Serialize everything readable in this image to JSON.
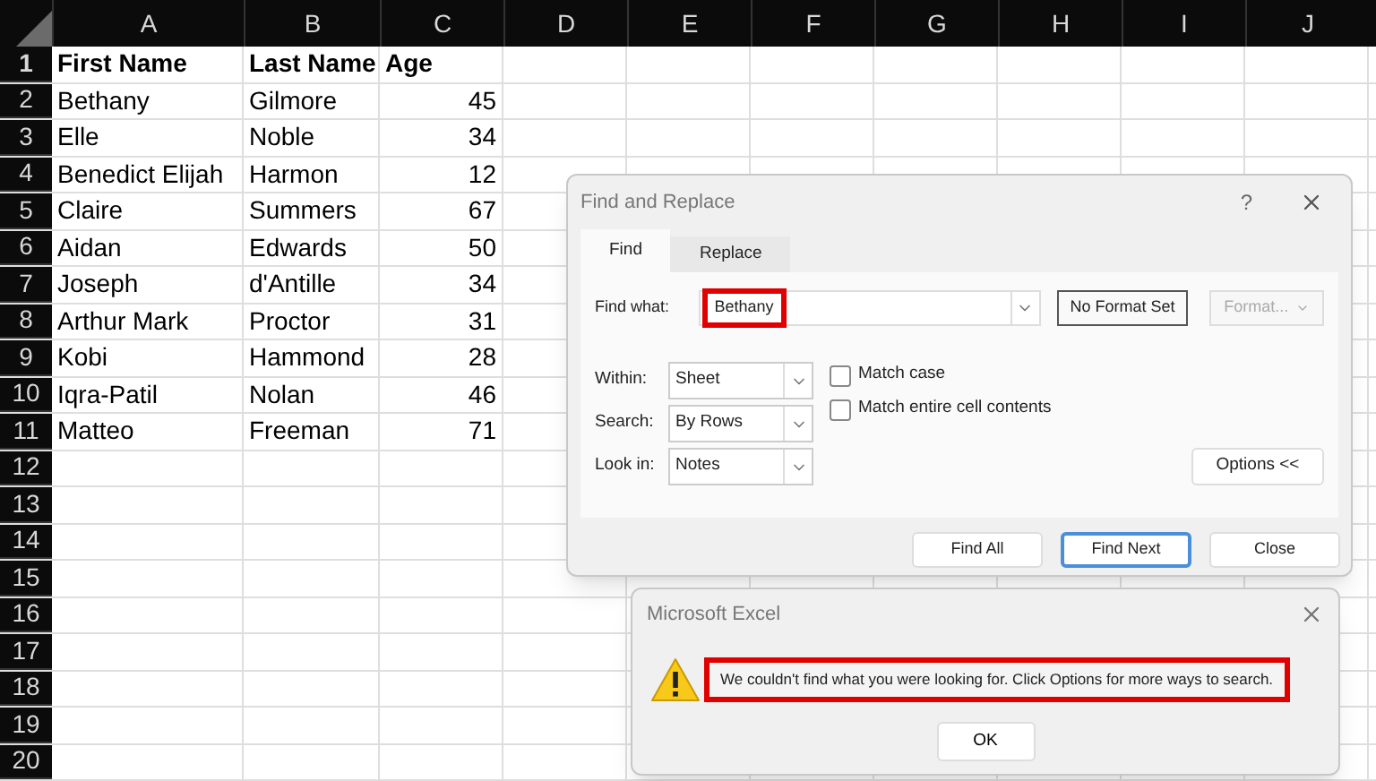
{
  "spreadsheet": {
    "columns": [
      "A",
      "B",
      "C",
      "D",
      "E",
      "F",
      "G",
      "H",
      "I",
      "J"
    ],
    "rows": [
      {
        "number": "1",
        "header": true,
        "cells": [
          "First Name",
          "Last Name",
          "Age"
        ]
      },
      {
        "number": "2",
        "header": false,
        "cells": [
          "Bethany",
          "Gilmore",
          "45"
        ]
      },
      {
        "number": "3",
        "header": false,
        "cells": [
          "Elle",
          "Noble",
          "34"
        ]
      },
      {
        "number": "4",
        "header": false,
        "cells": [
          "Benedict Elijah",
          "Harmon",
          "12"
        ]
      },
      {
        "number": "5",
        "header": false,
        "cells": [
          "Claire",
          "Summers",
          "67"
        ]
      },
      {
        "number": "6",
        "header": false,
        "cells": [
          "Aidan",
          "Edwards",
          "50"
        ]
      },
      {
        "number": "7",
        "header": false,
        "cells": [
          "Joseph",
          "d'Antille",
          "34"
        ]
      },
      {
        "number": "8",
        "header": false,
        "cells": [
          "Arthur Mark",
          "Proctor",
          "31"
        ]
      },
      {
        "number": "9",
        "header": false,
        "cells": [
          "Kobi",
          "Hammond",
          "28"
        ]
      },
      {
        "number": "10",
        "header": false,
        "cells": [
          "Iqra-Patil",
          "Nolan",
          "46"
        ]
      },
      {
        "number": "11",
        "header": false,
        "cells": [
          "Matteo",
          "Freeman",
          "71"
        ]
      },
      {
        "number": "12",
        "header": false,
        "cells": []
      },
      {
        "number": "13",
        "header": false,
        "cells": []
      },
      {
        "number": "14",
        "header": false,
        "cells": []
      },
      {
        "number": "15",
        "header": false,
        "cells": []
      },
      {
        "number": "16",
        "header": false,
        "cells": []
      },
      {
        "number": "17",
        "header": false,
        "cells": []
      },
      {
        "number": "18",
        "header": false,
        "cells": []
      },
      {
        "number": "19",
        "header": false,
        "cells": []
      },
      {
        "number": "20",
        "header": false,
        "cells": []
      }
    ]
  },
  "find_dialog": {
    "title": "Find and Replace",
    "help": "?",
    "tabs": [
      {
        "label": "Find",
        "selected": true
      },
      {
        "label": "Replace",
        "selected": false
      }
    ],
    "find_what": {
      "label": "Find what:",
      "value": "Bethany",
      "highlighted": true
    },
    "format_status": "No Format Set",
    "format_button": {
      "label": "Format...",
      "disabled": true
    },
    "selects": [
      {
        "label": "Within:",
        "value": "Sheet"
      },
      {
        "label": "Search:",
        "value": "By Rows"
      },
      {
        "label": "Look in:",
        "value": "Notes"
      }
    ],
    "checkboxes": [
      {
        "label": "Match case",
        "checked": false
      },
      {
        "label": "Match entire cell contents",
        "checked": false
      }
    ],
    "options_button": "Options <<",
    "buttons": [
      {
        "label": "Find All",
        "default": false
      },
      {
        "label": "Find Next",
        "default": true
      },
      {
        "label": "Close",
        "default": false
      }
    ]
  },
  "message_box": {
    "title": "Microsoft Excel",
    "text": "We couldn't find what you were looking for. Click Options for more ways to search.",
    "highlighted": true,
    "button": "OK"
  }
}
